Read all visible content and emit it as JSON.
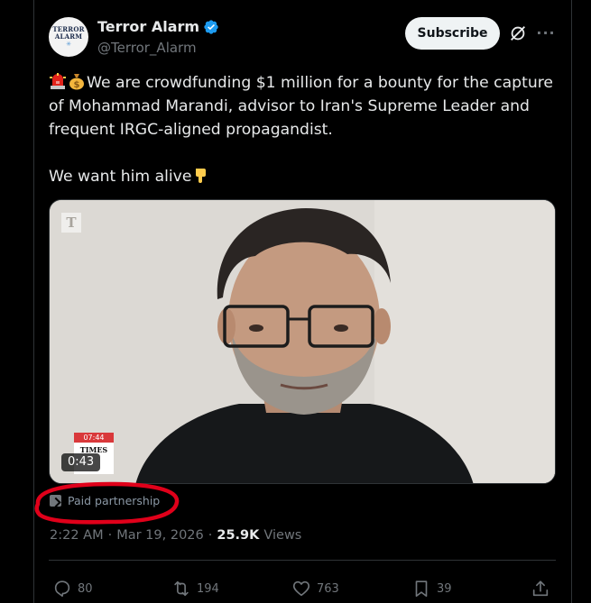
{
  "post": {
    "author": {
      "display_name": "Terror Alarm",
      "handle": "@Terror_Alarm",
      "avatar_text_line1": "TERROR",
      "avatar_text_line2": "ALARM",
      "verified": true
    },
    "header": {
      "subscribe_label": "Subscribe",
      "grok_icon": "grok-icon",
      "more_icon": "more-options-icon",
      "more_glyph": "···"
    },
    "text": {
      "line1": "We are crowdfunding $1 million for a bounty for the capture of Mohammad Marandi, advisor to Iran's Supreme Leader and frequent IRGC-aligned propagandist.",
      "line2": "We want him alive",
      "emoji_leading": [
        "police-light-emoji",
        "money-bag-emoji"
      ],
      "emoji_trailing": "pointing-down-emoji"
    },
    "media": {
      "type": "video",
      "watermark": "T",
      "thumbnail_time": "07:44",
      "thumbnail_label": "TIMES",
      "duration": "0:43"
    },
    "paid_partnership": "Paid partnership",
    "meta": {
      "time": "2:22 AM",
      "separator": "·",
      "date": "Mar 19, 2026",
      "views_count": "25.9K",
      "views_label": "Views"
    },
    "actions": {
      "replies": "80",
      "reposts": "194",
      "likes": "763",
      "bookmarks": "39"
    },
    "colors": {
      "background": "#000000",
      "text_primary": "#e7e9ea",
      "text_secondary": "#71767b",
      "verified_blue": "#1d9bf0",
      "annotation_red": "#e0001a"
    }
  }
}
